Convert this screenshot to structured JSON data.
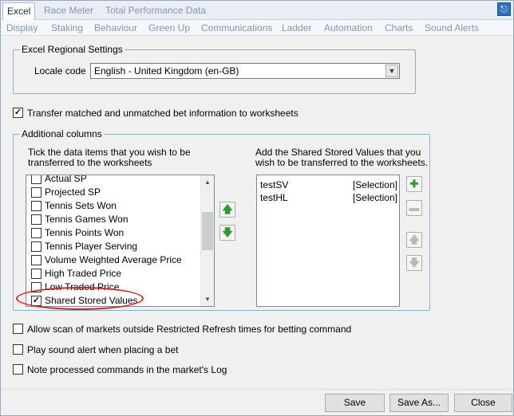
{
  "window": {
    "tabs_top": [
      {
        "label": "Excel",
        "active": true
      },
      {
        "label": "Race Meter",
        "active": false
      },
      {
        "label": "Total Performance Data",
        "active": false
      }
    ],
    "pin_icon": "pin-icon",
    "tabs_sub": [
      "Display",
      "Staking",
      "Behaviour",
      "Green Up",
      "Communications",
      "Ladder",
      "Automation",
      "Charts",
      "Sound Alerts"
    ]
  },
  "regional": {
    "title": "Excel Regional Settings",
    "locale_label": "Locale code",
    "locale_value": "English - United Kingdom (en-GB)"
  },
  "transfer": {
    "label": "Transfer matched and unmatched bet information to worksheets",
    "checked": true
  },
  "additional": {
    "title": "Additional columns",
    "left_instructions_1": "Tick the data items that you wish to be",
    "left_instructions_2": "transferred to the worksheets",
    "right_instructions_1": "Add the Shared Stored Values that you",
    "right_instructions_2": "wish to be transferred to the worksheets.",
    "items": [
      {
        "label": "Actual SP",
        "checked": false
      },
      {
        "label": "Projected SP",
        "checked": false
      },
      {
        "label": "Tennis Sets Won",
        "checked": false
      },
      {
        "label": "Tennis Games Won",
        "checked": false
      },
      {
        "label": "Tennis Points Won",
        "checked": false
      },
      {
        "label": "Tennis Player Serving",
        "checked": false
      },
      {
        "label": "Volume Weighted Average Price",
        "checked": false
      },
      {
        "label": "High Traded Price",
        "checked": false
      },
      {
        "label": "Low Traded Price",
        "checked": false
      },
      {
        "label": "Shared Stored Values",
        "checked": true
      }
    ],
    "ssv": [
      {
        "name": "testSV",
        "type": "[Selection]"
      },
      {
        "name": "testHL",
        "type": "[Selection]"
      }
    ]
  },
  "options": [
    {
      "label": "Allow scan of markets outside Restricted Refresh times for betting command",
      "checked": false
    },
    {
      "label": "Play sound alert when placing a bet",
      "checked": false
    },
    {
      "label": "Note processed commands in the market's Log",
      "checked": false
    }
  ],
  "buttons": {
    "save": "Save",
    "save_as": "Save As...",
    "close": "Close"
  },
  "colors": {
    "accent": "#2f6fc4",
    "green_icon": "#2f9a2f",
    "annotation": "#c42b2b"
  }
}
